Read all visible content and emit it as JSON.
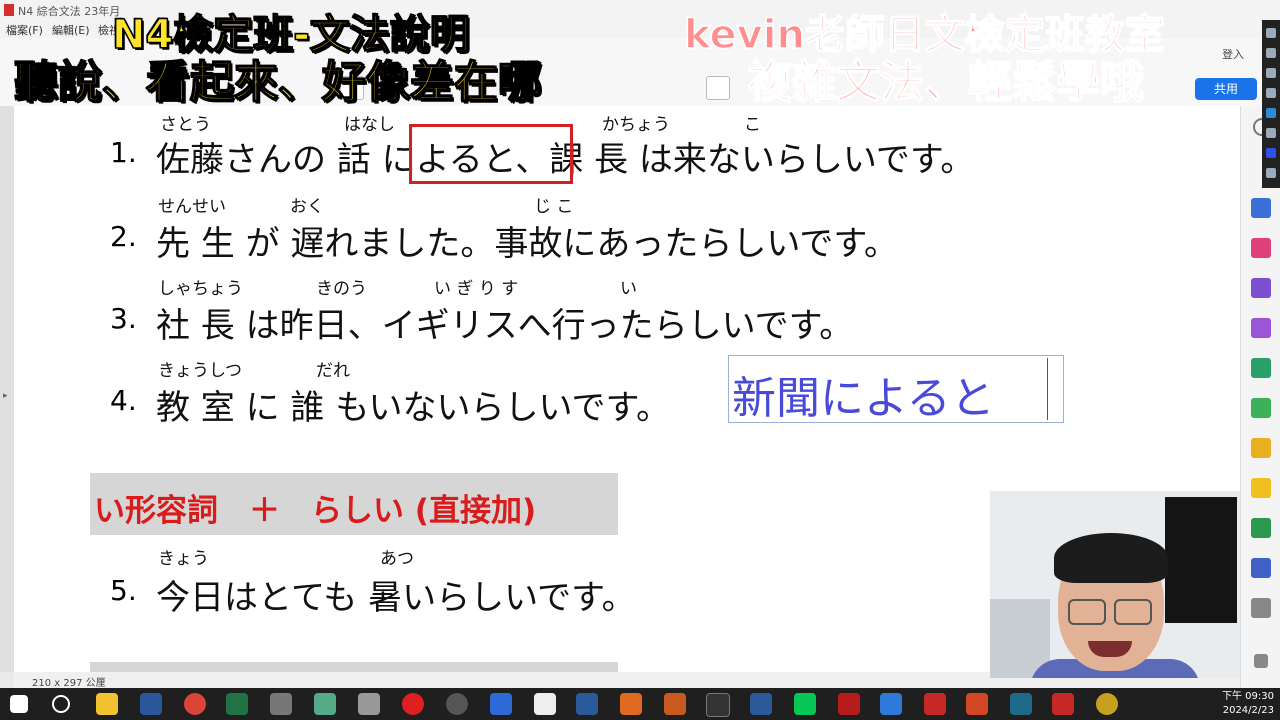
{
  "window": {
    "title": "N4 綜合文法 23年月"
  },
  "menu": [
    "檔案(F)",
    "編輯(E)",
    "檢視"
  ],
  "toolbar": {
    "share_label": "共用",
    "signin_label": "登入"
  },
  "status": {
    "page_size": "210 x 297 公厘"
  },
  "overlays": {
    "left_line1": "N4檢定班-文法說明",
    "left_line2": "聽說、看起來、好像差在哪",
    "right_line1": "kevin老師日文檢定班教室",
    "right_line2": "複雜文法、輕鬆學哦"
  },
  "sentences": [
    {
      "num": "1.",
      "text": "佐藤さんの 話 によると、課 長 は来ないらしいです。",
      "ruby": [
        {
          "t": "さとう"
        },
        {
          "t": "はなし"
        },
        {
          "t": "かちょう"
        },
        {
          "t": "こ"
        }
      ]
    },
    {
      "num": "2.",
      "text": "先 生 が 遅れました。事故にあったらしいです。",
      "ruby": [
        {
          "t": "せんせい"
        },
        {
          "t": "おく"
        },
        {
          "t": "じ こ"
        }
      ]
    },
    {
      "num": "3.",
      "text": "社 長 は昨日、イギリスへ行ったらしいです。",
      "ruby": [
        {
          "t": "しゃちょう"
        },
        {
          "t": "きのう"
        },
        {
          "t": "い ぎ り す"
        },
        {
          "t": "い"
        }
      ]
    },
    {
      "num": "4.",
      "text": "教 室 に 誰 もいないらしいです。",
      "ruby": [
        {
          "t": "きょうしつ"
        },
        {
          "t": "だれ"
        }
      ]
    },
    {
      "num": "5.",
      "text": "今日はとても 暑いらしいです。",
      "ruby": [
        {
          "t": "きょう"
        },
        {
          "t": "あつ"
        }
      ]
    }
  ],
  "textbox": {
    "text": "新聞によると"
  },
  "grammar_heading": "い形容詞　＋　らしい (直接加)",
  "clock": {
    "time": "下午 09:30",
    "date": "2024/2/23"
  },
  "colors": {
    "highlight_red": "#d42020",
    "textbox_blue": "#4a4ad8",
    "overlay_yellow": "#ffe32a",
    "overlay_pink": "#ff8e8e",
    "share_blue": "#1a73e8"
  }
}
